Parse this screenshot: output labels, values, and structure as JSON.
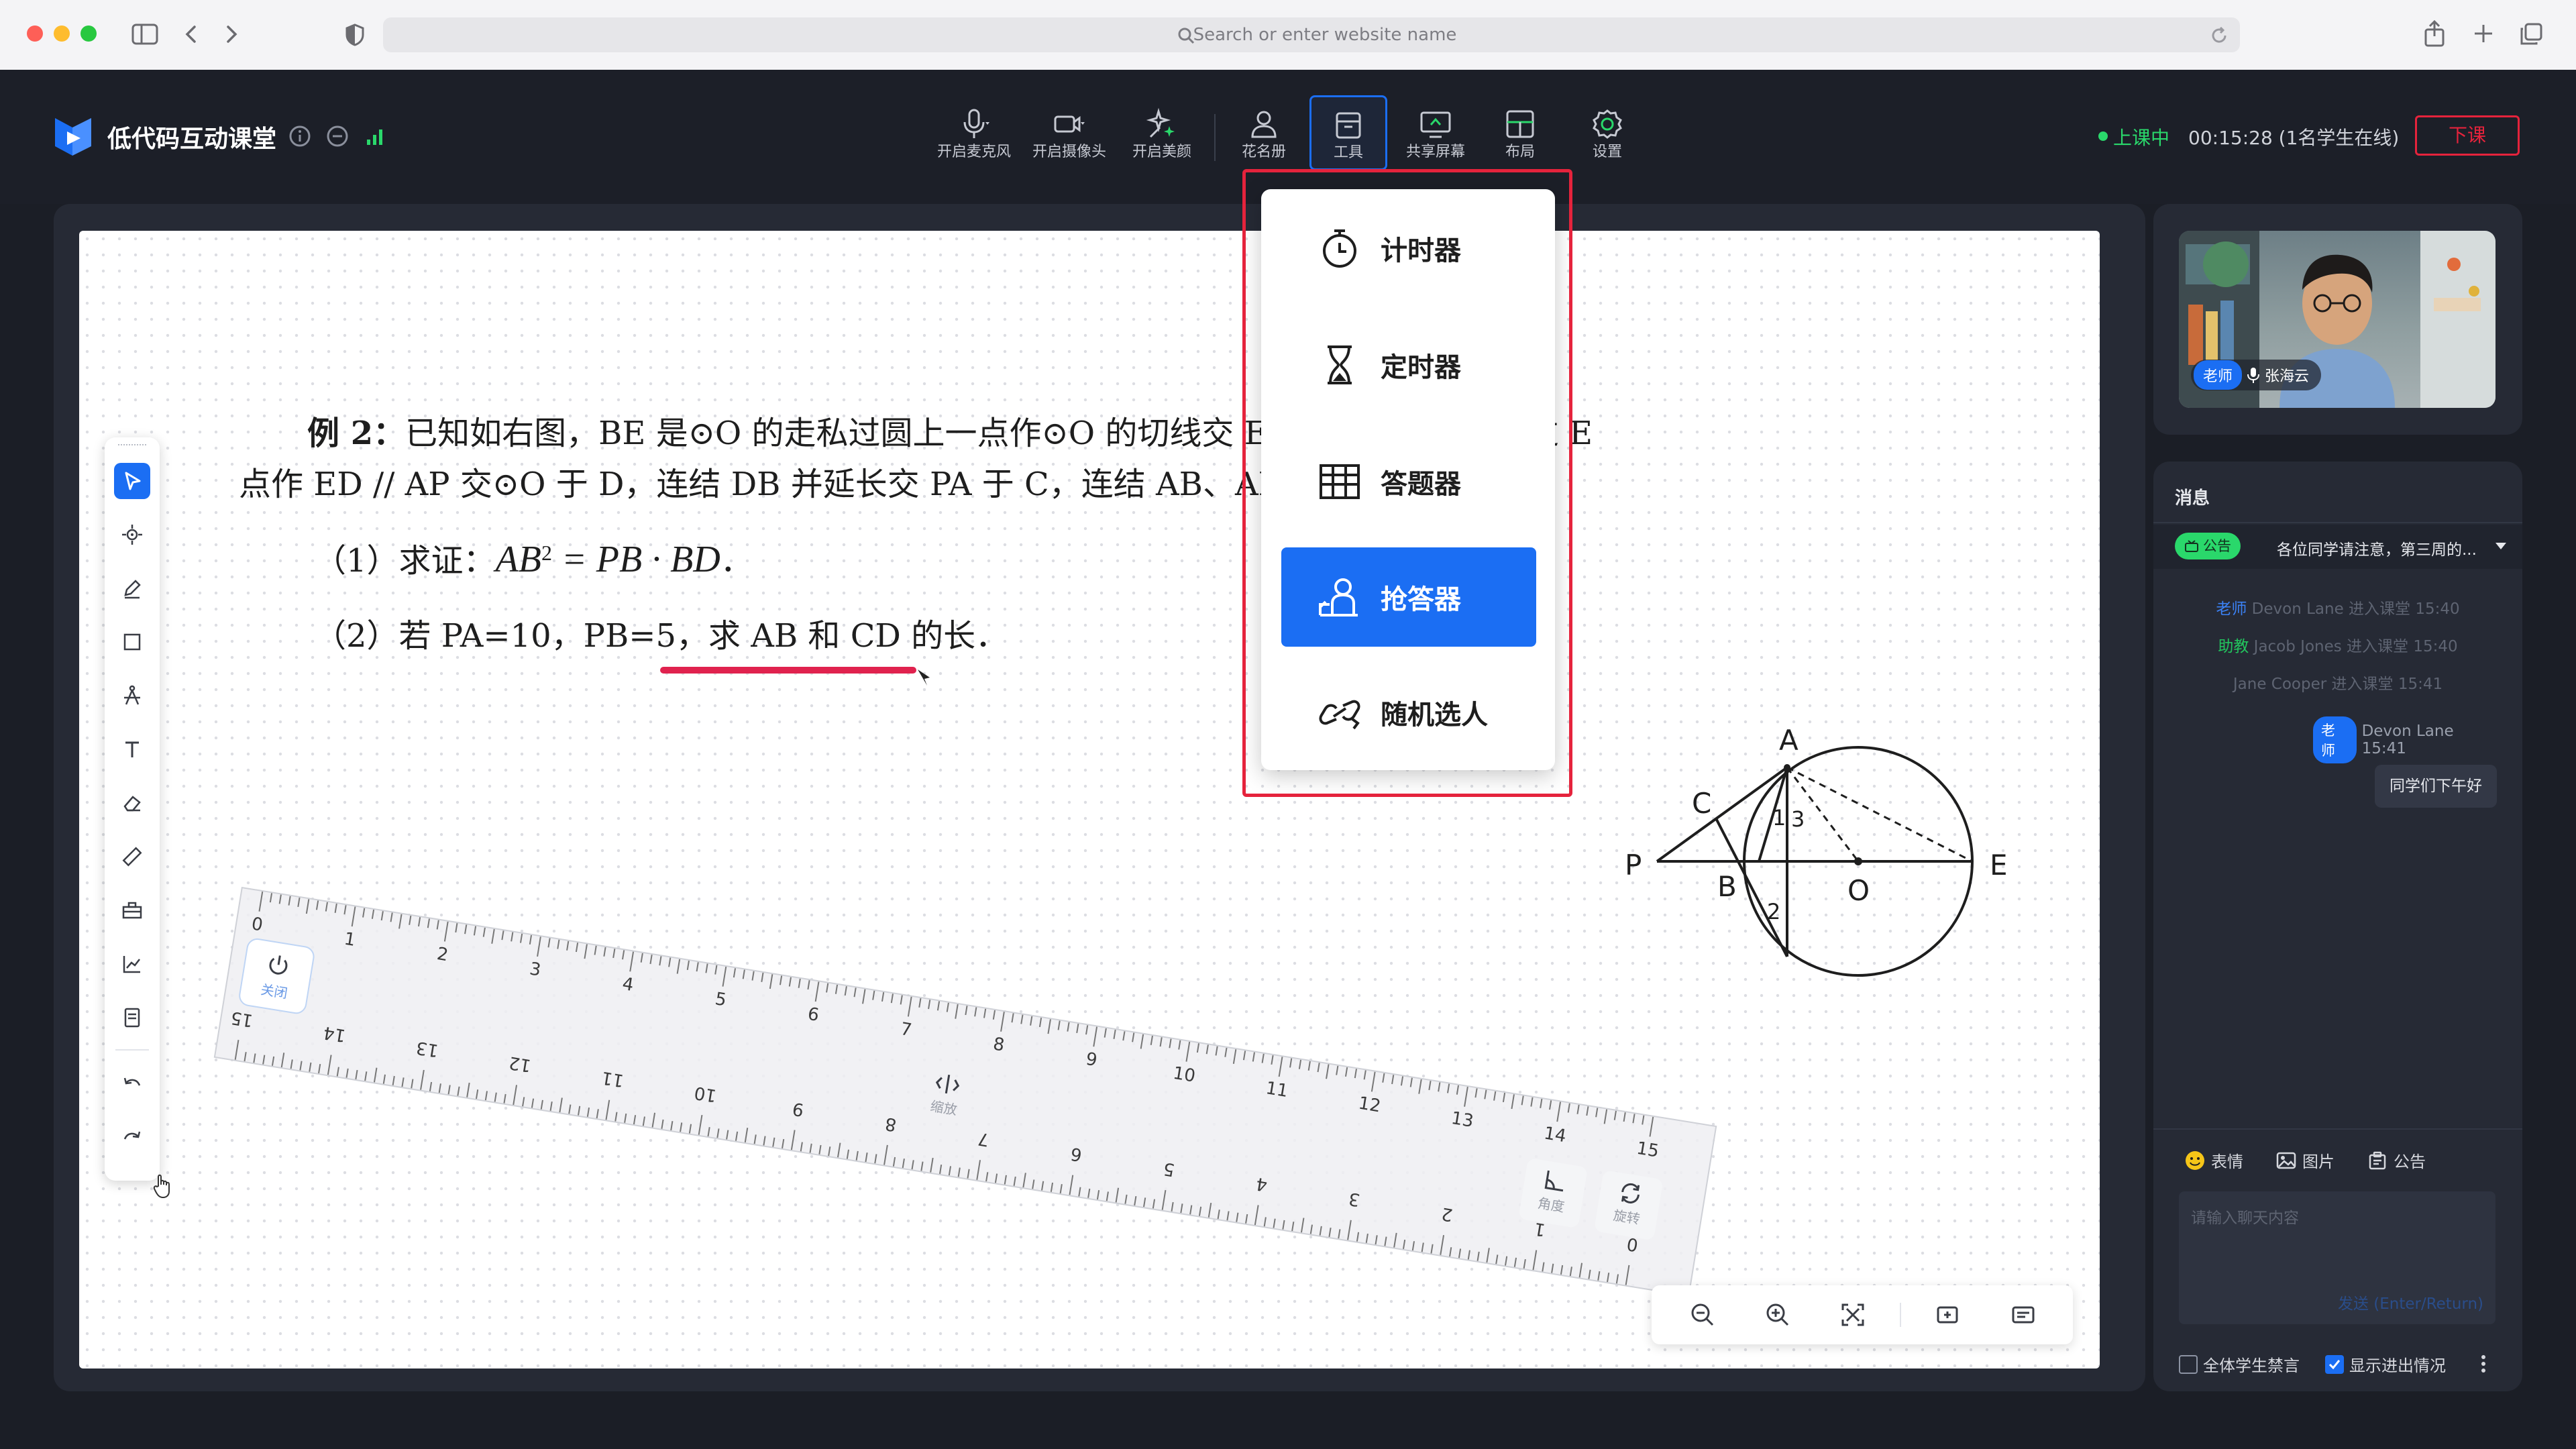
{
  "browser": {
    "url_placeholder": "Search or enter website name"
  },
  "app": {
    "title": "低代码互动课堂",
    "status": "上课中",
    "timer": "00:15:28 (1名学生在线)",
    "end_class_label": "下课",
    "accent_color": "#1b6ef3",
    "live_color": "#2ad86b",
    "danger_color": "#e5233c"
  },
  "toolbar": {
    "items": [
      {
        "label": "开启麦克风",
        "icon": "microphone-icon"
      },
      {
        "label": "开启摄像头",
        "icon": "camera-icon"
      },
      {
        "label": "开启美颜",
        "icon": "beauty-icon"
      },
      {
        "label": "花名册",
        "icon": "roster-icon"
      },
      {
        "label": "工具",
        "icon": "toolbox-icon"
      },
      {
        "label": "共享屏幕",
        "icon": "share-screen-icon"
      },
      {
        "label": "布局",
        "icon": "layout-icon"
      },
      {
        "label": "设置",
        "icon": "settings-icon"
      }
    ],
    "active": "工具"
  },
  "tools_menu": {
    "items": [
      {
        "label": "计时器",
        "icon": "stopwatch-icon"
      },
      {
        "label": "定时器",
        "icon": "hourglass-icon"
      },
      {
        "label": "答题器",
        "icon": "answer-grid-icon"
      },
      {
        "label": "抢答器",
        "icon": "quick-answer-icon"
      },
      {
        "label": "随机选人",
        "icon": "random-pick-icon"
      }
    ],
    "selected": "抢答器"
  },
  "problem": {
    "intro_bold": "例 2：",
    "line1": "已知如右图，BE 是⊙O 的走私过圆上一点作⊙O 的切线交 EB 的延长线于 P．过 E",
    "line2": "点作 ED // AP 交⊙O 于 D，连结 DB 并延长交 PA 于 C，连结 AB、AD．",
    "q1_prefix": "（1）求证：",
    "q1_math_a": "AB",
    "q1_math_exp": "2",
    "q1_math_b": " = PB · BD",
    "q1_suffix": "．",
    "q2": "（2）若 PA=10，PB=5，求 AB 和 CD 的长．"
  },
  "ruler": {
    "top_numbers": [
      "0",
      "1",
      "2",
      "3",
      "4",
      "5",
      "6",
      "7",
      "8",
      "9",
      "10",
      "11",
      "12",
      "13",
      "14",
      "15"
    ],
    "bottom_numbers": [
      "15",
      "14",
      "13",
      "12",
      "11",
      "10",
      "9",
      "8",
      "7",
      "6",
      "5",
      "4",
      "3",
      "2",
      "1",
      "0"
    ],
    "close_label": "关闭",
    "scale_label": "缩放",
    "angle_label": "角度",
    "rotate_label": "旋转"
  },
  "diagram": {
    "labels": [
      "A",
      "C",
      "P",
      "B",
      "O",
      "E",
      "1",
      "2",
      "3"
    ]
  },
  "video": {
    "role_badge": "老师",
    "name": "张海云"
  },
  "chat": {
    "title": "消息",
    "announcement_badge": "公告",
    "announcement_text": "各位同学请注意，第三周的...",
    "system_messages": [
      {
        "role": "老师",
        "text": "Devon Lane 进入课堂 15:40",
        "role_color": "#3b82f6"
      },
      {
        "role": "助教",
        "text": "Jacob Jones 进入课堂 15:40",
        "role_color": "#22c55e"
      },
      {
        "role": "",
        "text": "Jane Cooper 进入课堂 15:41",
        "role_color": "#5e6472"
      }
    ],
    "message_meta_role": "老师",
    "message_meta": "Devon Lane 15:41",
    "message_text": "同学们下午好",
    "emoji_label": "表情",
    "image_label": "图片",
    "notice_label": "公告",
    "input_placeholder": "请输入聊天内容",
    "send_label": "发送 (Enter/Return)",
    "mute_all_label": "全体学生禁言",
    "show_entry_label": "显示进出情况",
    "mute_all_checked": false,
    "show_entry_checked": true
  }
}
